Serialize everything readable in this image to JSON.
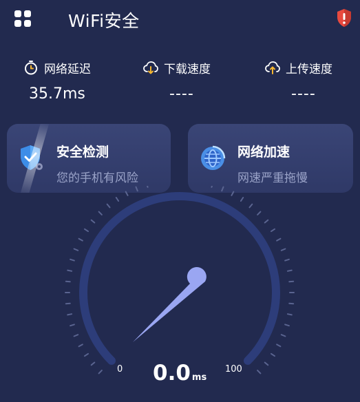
{
  "header": {
    "title": "WiFi安全",
    "menu_icon": "grid-icon",
    "alert_icon": "shield-alert-icon",
    "alert_color": "#e94a3f"
  },
  "stats": [
    {
      "label": "网络延迟",
      "value": "35.7ms",
      "icon": "stopwatch-icon"
    },
    {
      "label": "下载速度",
      "value": "----",
      "icon": "cloud-download-icon"
    },
    {
      "label": "上传速度",
      "value": "----",
      "icon": "cloud-upload-icon"
    }
  ],
  "cards": [
    {
      "title": "安全检测",
      "subtitle": "您的手机有风险",
      "icon": "shield-check-icon"
    },
    {
      "title": "网络加速",
      "subtitle": "网速严重拖慢",
      "icon": "globe-icon"
    }
  ],
  "gauge": {
    "min_label": "0",
    "max_label": "100",
    "reading": "0.0",
    "unit": "ms"
  },
  "colors": {
    "background": "#222a4f",
    "card": "#36416f",
    "gauge_ring": "#2d3d7a",
    "needle": "#9aa6f2",
    "accent_yellow": "#f5b630"
  }
}
